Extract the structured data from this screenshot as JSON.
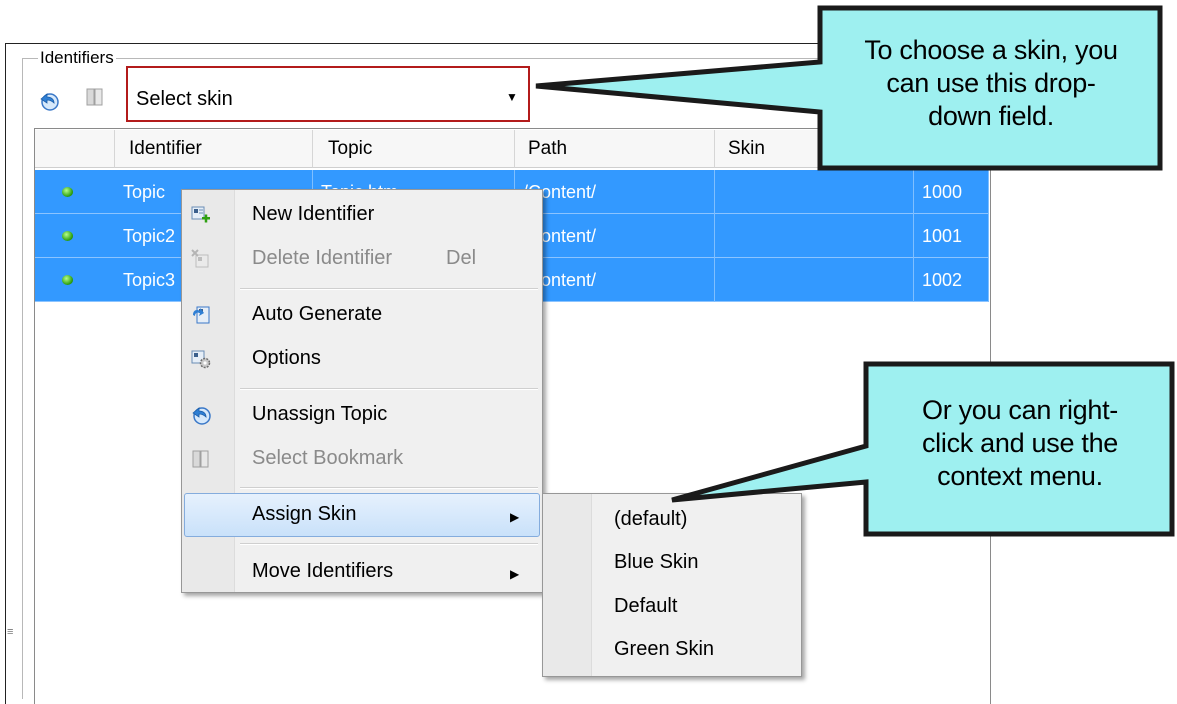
{
  "group": {
    "label": "Identifiers"
  },
  "toolbar": {
    "skin_select": {
      "value": "Select skin"
    }
  },
  "grid": {
    "headers": [
      "",
      "Identifier",
      "Topic",
      "Path",
      "Skin",
      ""
    ],
    "rows": [
      {
        "identifier": "Topic",
        "topic": "Topic.htm",
        "path": "/Content/",
        "skin": "",
        "id": "1000"
      },
      {
        "identifier": "Topic2",
        "topic": "",
        "path": "/Content/",
        "skin": "",
        "id": "1001"
      },
      {
        "identifier": "Topic3",
        "topic": "",
        "path": "/Content/",
        "skin": "",
        "id": "1002"
      }
    ],
    "selection_color": "#3399ff"
  },
  "context_menu": {
    "items": [
      {
        "label": "New Identifier",
        "shortcut": "",
        "enabled": true,
        "icon": "new-identifier-icon"
      },
      {
        "label": "Delete Identifier",
        "shortcut": "Del",
        "enabled": false,
        "icon": "delete-identifier-icon"
      },
      {
        "label": "Auto Generate",
        "shortcut": "",
        "enabled": true,
        "icon": "auto-generate-icon"
      },
      {
        "label": "Options",
        "shortcut": "",
        "enabled": true,
        "icon": "options-icon"
      },
      {
        "label": "Unassign Topic",
        "shortcut": "",
        "enabled": true,
        "icon": "unassign-topic-icon"
      },
      {
        "label": "Select Bookmark",
        "shortcut": "",
        "enabled": false,
        "icon": "bookmark-icon"
      },
      {
        "label": "Assign Skin",
        "shortcut": "",
        "enabled": true,
        "submenu": true,
        "highlighted": true
      },
      {
        "label": "Move Identifiers",
        "shortcut": "",
        "enabled": true,
        "submenu": true
      }
    ]
  },
  "submenu": {
    "items": [
      "(default)",
      "Blue Skin",
      "Default",
      "Green Skin"
    ]
  },
  "callouts": {
    "top": {
      "lines": [
        "To choose a skin, you",
        "can use this drop-",
        "down field."
      ]
    },
    "bottom": {
      "lines": [
        "Or you can right-",
        "click and use the",
        "context menu."
      ]
    },
    "fill": "#9ef0f0",
    "border": "#1a1a1a",
    "highlight_border": "#b31b1b"
  }
}
